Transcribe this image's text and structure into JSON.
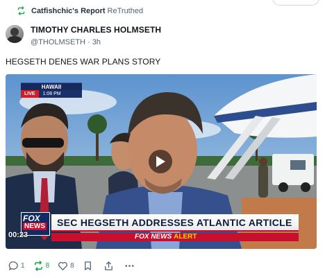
{
  "retruth_bar": {
    "reposter_name": "Catfishchic's Report",
    "action_label": "ReTruthed"
  },
  "post": {
    "author": {
      "display_name": "TIMOTHY CHARLES HOLMSETH",
      "handle": "@THOLMSETH",
      "separator": "·",
      "age": "3h"
    },
    "text": "HEGSETH DENES WAR PLANS STORY",
    "video": {
      "location": "HAWAII",
      "live_badge": "LIVE",
      "live_time": "1:08 PM",
      "network_logo_top": "FOX",
      "network_logo_bottom": "NEWS",
      "headline": "SEC HEGSETH ADDRESSES ATLANTIC ARTICLE",
      "alert_brand": "FOX NEWS",
      "alert_word": "ALERT",
      "duration": "00:23"
    }
  },
  "actions": {
    "replies": "1",
    "retruths": "8",
    "likes": "8"
  },
  "colors": {
    "retruth_green": "#17a34a",
    "text_secondary": "#536471",
    "fox_red": "#c8102e",
    "fox_navy": "#0f2a66"
  }
}
